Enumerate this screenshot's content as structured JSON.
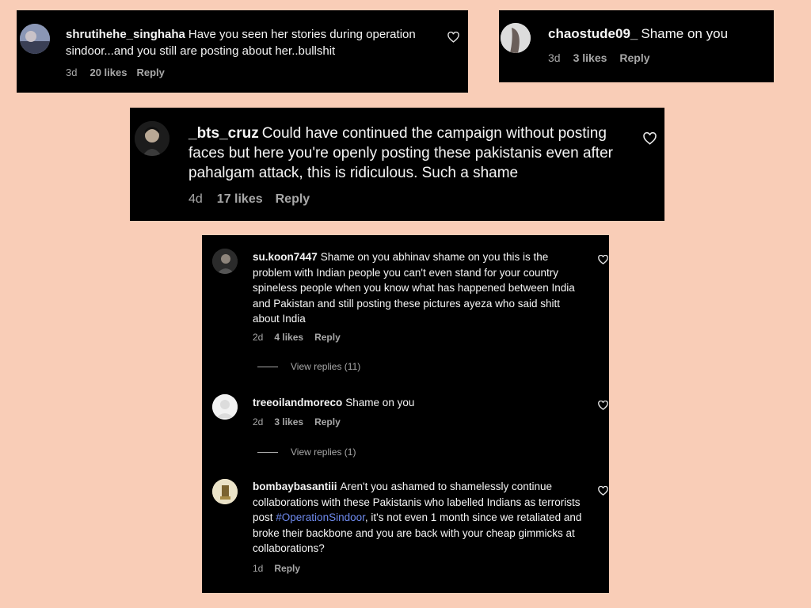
{
  "comments_top_left": {
    "username": "shrutihehe_singhaha",
    "text": "Have you seen her stories during operation sindoor...and you still are posting about her..bullshit",
    "time": "3d",
    "likes": "20 likes",
    "reply": "Reply"
  },
  "comments_top_right": {
    "username": "chaostude09_",
    "text": "Shame on you",
    "time": "3d",
    "likes": "3 likes",
    "reply": "Reply"
  },
  "comments_middle": {
    "username": "_bts_cruz",
    "text": "Could have continued the campaign without posting faces but here you're openly posting these pakistanis even after pahalgam attack, this is ridiculous. Such a shame",
    "time": "4d",
    "likes": "17 likes",
    "reply": "Reply"
  },
  "thread": {
    "c1": {
      "username": "su.koon7447",
      "text": "Shame on you abhinav shame on you this is the problem with Indian people you can't even stand for your country spineless people when you know what has happened between India and Pakistan and still posting these pictures ayeza who said shitt about India",
      "time": "2d",
      "likes": "4 likes",
      "reply": "Reply",
      "view_replies": "View replies (11)"
    },
    "c2": {
      "username": "treeoilandmoreco",
      "text": "Shame on you",
      "time": "2d",
      "likes": "3 likes",
      "reply": "Reply",
      "view_replies": "View replies (1)"
    },
    "c3": {
      "username": "bombaybasantiii",
      "text_before": "Aren't you ashamed to shamelessly continue collaborations with these Pakistanis who labelled Indians as terrorists post ",
      "hashtag": "#OperationSindoor",
      "text_after": ", it's not even 1 month since we retaliated and broke their backbone and you are back with your cheap gimmicks at collaborations?",
      "time": "1d",
      "reply": "Reply"
    }
  },
  "colors": {
    "background": "#f9cdb7",
    "card": "#000000",
    "muted_text": "#a8a8a8",
    "hashtag": "#6f8bef"
  },
  "icons": {
    "like": "heart-outline-icon",
    "avatar_placeholder": "default-avatar-icon"
  }
}
